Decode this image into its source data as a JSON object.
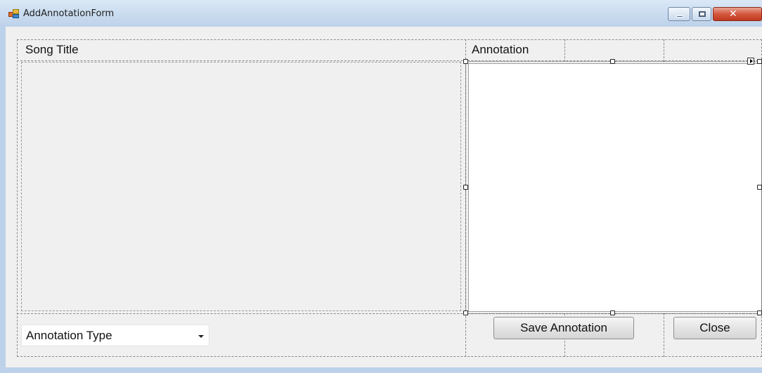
{
  "window": {
    "title": "AddAnnotationForm",
    "buttons": {
      "minimize": "minimize",
      "maximize": "maximize",
      "close": "close"
    }
  },
  "form": {
    "song_title_label": "Song Title",
    "annotation_label": "Annotation",
    "annotation_type": {
      "selected": "Annotation Type"
    },
    "save_button": "Save Annotation",
    "close_button": "Close"
  },
  "icons": {
    "app": "app-icon",
    "minimize": "minimize-icon",
    "maximize": "maximize-icon",
    "close": "close-icon",
    "dropdown": "chevron-down-icon",
    "smart_tag": "smart-tag-icon"
  },
  "colors": {
    "titlebar": "#c9dbef",
    "client_background": "#f0f0f0",
    "close_button": "#c0391f",
    "textbox_background": "#ffffff"
  }
}
